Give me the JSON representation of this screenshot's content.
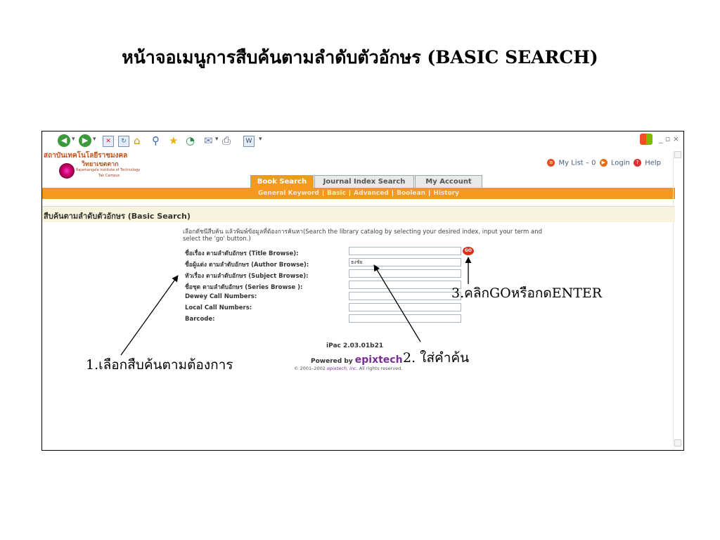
{
  "slide": {
    "title": "หน้าจอเมนูการสืบค้นตามลำดับตัวอักษร (BASIC  SEARCH)"
  },
  "browser": {
    "toolbar_icons": [
      "back-icon",
      "forward-icon",
      "stop-icon",
      "refresh-icon",
      "home-icon",
      "search-icon",
      "favorites-icon",
      "history-icon",
      "mail-icon",
      "print-icon",
      "edit-icon"
    ],
    "window_controls": "_ ▫ ×"
  },
  "header": {
    "institution_line1": "สถาบันเทคโนโลยีราชมงคล",
    "institution_line2": "วิทยาเขตตาก",
    "institution_line3": "Rajamangala Institute of Technology",
    "institution_line4": "Tak Campus",
    "top_links": {
      "my_list": "My List – 0",
      "login": "Login",
      "help": "Help"
    },
    "tabs": [
      {
        "label": "Book Search",
        "active": true
      },
      {
        "label": "Journal Index Search",
        "active": false
      },
      {
        "label": "My Account",
        "active": false
      }
    ],
    "subnav": [
      {
        "label": "General Keyword",
        "active": false
      },
      {
        "label": "Basic",
        "active": true
      },
      {
        "label": "Advanced",
        "active": false
      },
      {
        "label": "Boolean",
        "active": false
      },
      {
        "label": "History",
        "active": false
      }
    ]
  },
  "search_page": {
    "section_title": "สืบค้นตามลำดับตัวอักษร (Basic Search)",
    "instructions": "เลือกดัชนีสืบค้น แล้วพิมพ์ข้อมูลที่ต้องการค้นหา(Search the library catalog by selecting your desired index, input your term and select the 'go' button.)",
    "fields": [
      {
        "label": "ชื่อเรื่อง ตามลำดับอักษร (Title Browse):",
        "value": ""
      },
      {
        "label": "ชื่อผู้แต่ง ตามลำดับอักษร (Author Browse):",
        "value": "ธงชัย"
      },
      {
        "label": "หัวเรื่อง ตามลำดับอักษร (Subject Browse):",
        "value": ""
      },
      {
        "label": "ชื่อชุด ตามลำดับอักษร (Series Browse ):",
        "value": ""
      },
      {
        "label": "Dewey Call Numbers:",
        "value": ""
      },
      {
        "label": "Local Call Numbers:",
        "value": ""
      },
      {
        "label": "Barcode:",
        "value": ""
      }
    ],
    "go_label": "GO",
    "version": "iPac 2.03.01b21",
    "powered_by": "Powered by",
    "brand": "epixtech",
    "copyright_prefix": "© 2001–2002",
    "copyright_company": "epixtech, inc.",
    "copyright_suffix": "All rights reserved."
  },
  "annotations": {
    "step1": "1.เลือกสืบค้นตามต้องการ",
    "step2": "2. ใส่คำค้น",
    "step3": "3.คลิกGOหรือกดENTER"
  }
}
